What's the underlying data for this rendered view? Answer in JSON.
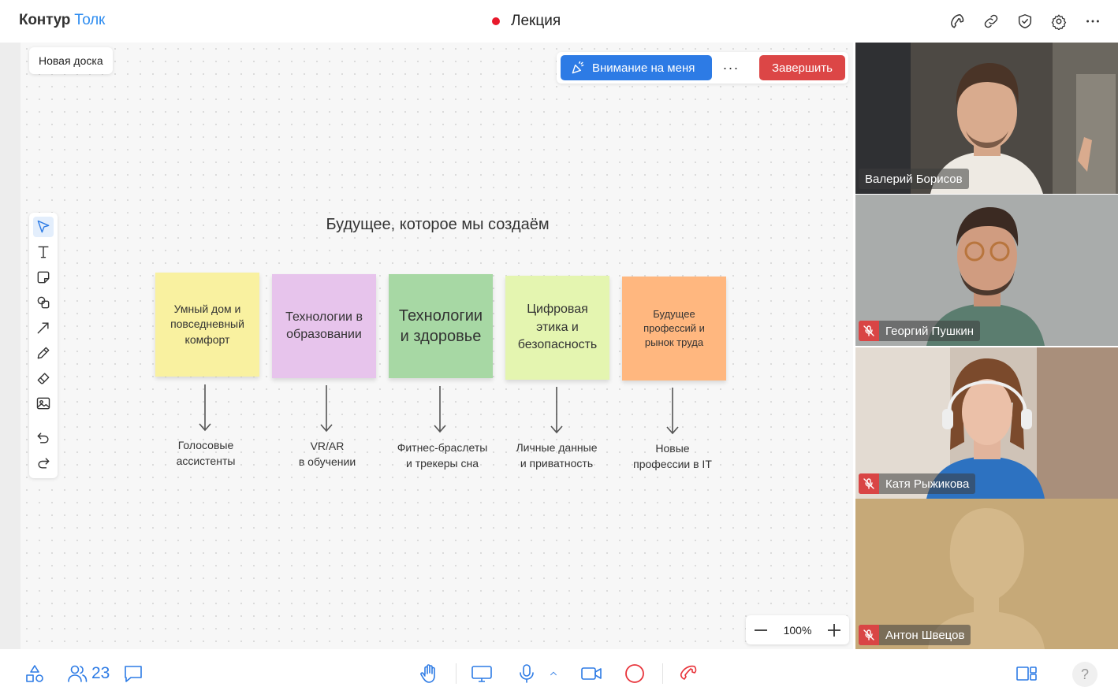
{
  "app": {
    "logo_brand": "Контур",
    "logo_product": "Толк",
    "meeting_title": "Лекция"
  },
  "header_icons": [
    "phone-icon",
    "link-icon",
    "shield-check-icon",
    "gear-icon",
    "more-icon"
  ],
  "board": {
    "name": "Новая доска",
    "title": "Будущее, которое мы создаём",
    "attention_button": "Внимание на меня",
    "more_button": "···",
    "end_button": "Завершить",
    "zoom_level": "100%",
    "tools": [
      "cursor-icon",
      "text-icon",
      "sticky-note-icon",
      "shapes-icon",
      "arrow-icon",
      "pencil-icon",
      "eraser-icon",
      "image-icon",
      "undo-icon",
      "redo-icon"
    ],
    "notes": [
      {
        "text": "Умный дом и повседневный комфорт",
        "color": "#f9f1a0",
        "caption_1": "Голосовые",
        "caption_2": "ассистенты"
      },
      {
        "text": "Технологии в образовании",
        "color": "#e7c4ec",
        "caption_1": "VR/AR",
        "caption_2": "в обучении"
      },
      {
        "text": "Технологии и здоровье",
        "color": "#a7d8a4",
        "caption_1": "Фитнес-браслеты",
        "caption_2": "и трекеры сна"
      },
      {
        "text": "Цифровая этика и безопасность",
        "color": "#e4f5b0",
        "caption_1": "Личные данные",
        "caption_2": "и приватность"
      },
      {
        "text": "Будущее профессий и рынок труда",
        "color": "#ffb77f",
        "caption_1": "Новые",
        "caption_2": "профессии в IT"
      }
    ]
  },
  "participants": [
    {
      "name": "Валерий Борисов",
      "muted": false,
      "speaking": true
    },
    {
      "name": "Георгий Пушкин",
      "muted": true,
      "speaking": false
    },
    {
      "name": "Катя Рыжикова",
      "muted": true,
      "speaking": false
    },
    {
      "name": "Антон Швецов",
      "muted": true,
      "speaking": false
    }
  ],
  "bottom_bar": {
    "participants_count": "23",
    "help": "?"
  },
  "colors": {
    "accent": "#2d7be5",
    "end_red": "#dc4646",
    "rec_dot": "#e8192c",
    "mute_red": "#d94545"
  }
}
